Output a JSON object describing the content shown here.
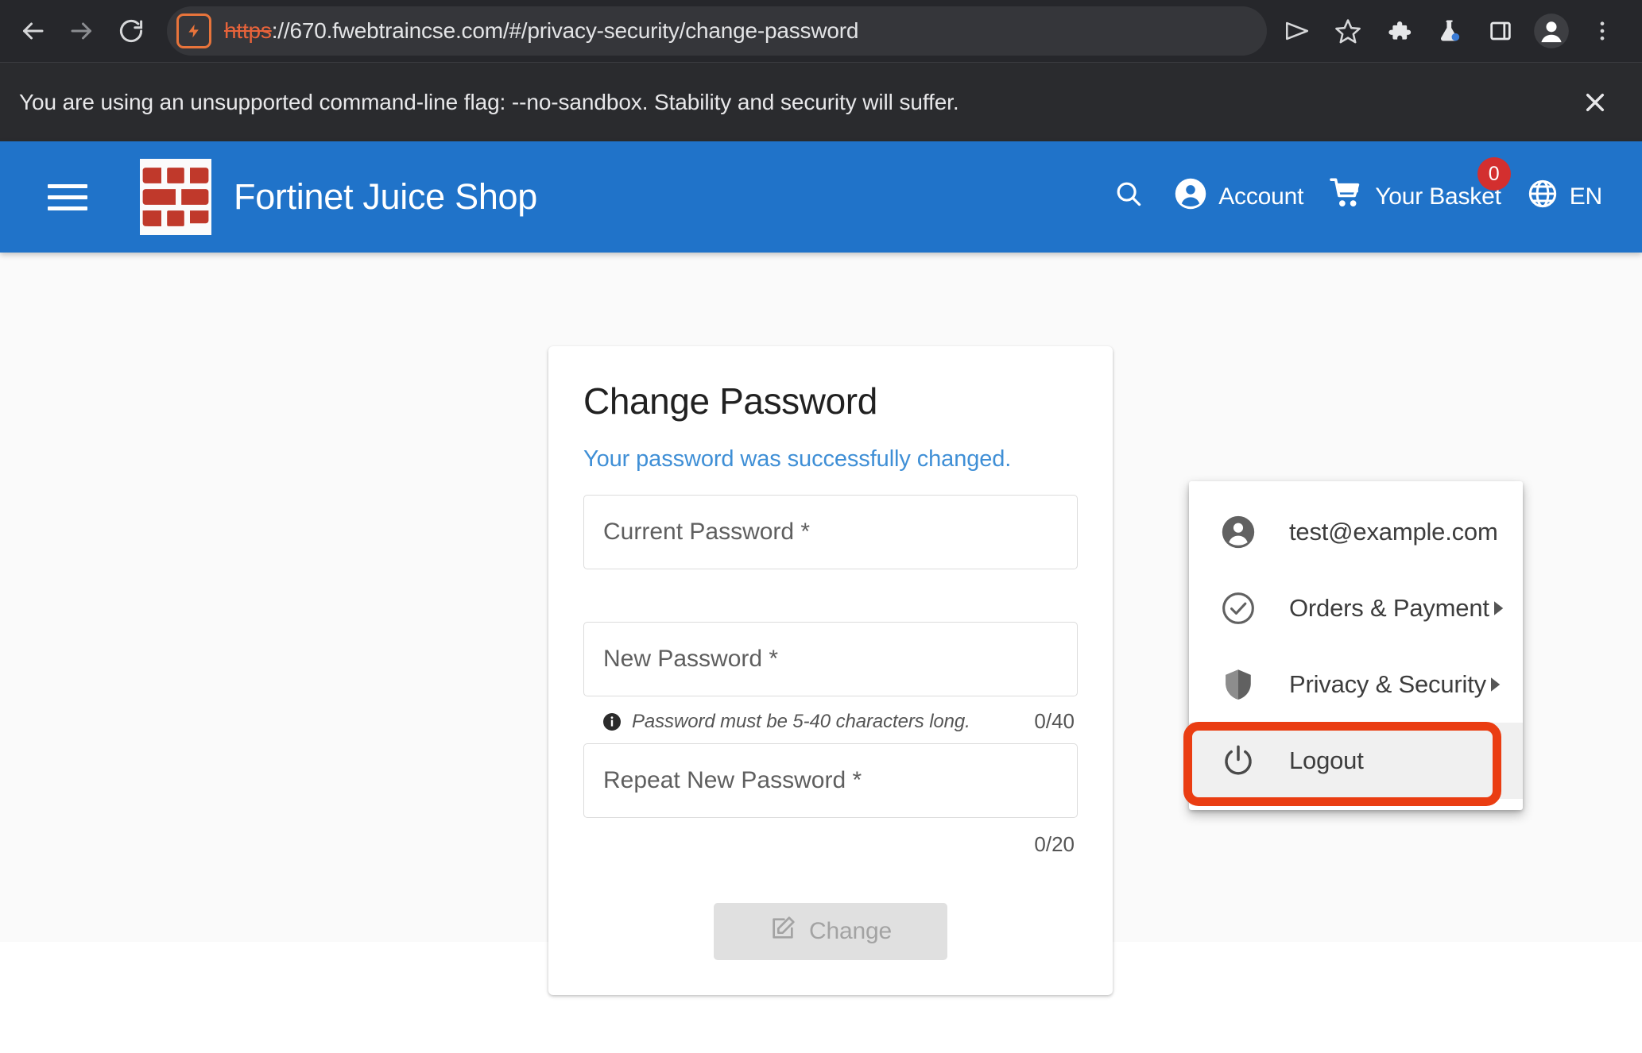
{
  "browser": {
    "nav": {
      "back_icon": "arrow-left-icon",
      "forward_icon": "arrow-right-icon",
      "reload_icon": "reload-icon"
    },
    "omnibox": {
      "site_badge_icon": "not-secure-lightning-icon",
      "url_scheme": "https",
      "url_rest": "://670.fwebtraincse.com/#/privacy-security/change-password",
      "full_url": "https://670.fwebtraincse.com/#/privacy-security/change-password"
    },
    "toolbar_icons": [
      {
        "name": "share-icon"
      },
      {
        "name": "star-bookmark-icon"
      },
      {
        "name": "extensions-puzzle-icon"
      },
      {
        "name": "labs-flask-icon"
      },
      {
        "name": "side-panel-icon"
      },
      {
        "name": "profile-avatar-icon"
      },
      {
        "name": "three-dot-menu-icon"
      }
    ],
    "infobar": {
      "message": "You are using an unsupported command-line flag: --no-sandbox. Stability and security will suffer.",
      "close_icon": "close-icon"
    }
  },
  "app_header": {
    "menu_icon": "hamburger-menu-icon",
    "logo_icon": "fortinet-logo-icon",
    "title": "Fortinet Juice Shop",
    "search_icon": "search-icon",
    "account": {
      "icon": "account-person-icon",
      "label": "Account"
    },
    "basket": {
      "icon": "shopping-cart-icon",
      "label": "Your Basket",
      "badge_count": "0"
    },
    "language": {
      "icon": "globe-icon",
      "label": "EN"
    },
    "colors": {
      "header_blue": "#2073c9",
      "badge_red": "#d32f2f"
    }
  },
  "account_menu": {
    "items": [
      {
        "icon": "account-person-icon",
        "label": "test@example.com",
        "has_submenu": false,
        "highlighted": false
      },
      {
        "icon": "check-circle-icon",
        "label": "Orders & Payment",
        "has_submenu": true,
        "highlighted": false
      },
      {
        "icon": "shield-icon",
        "label": "Privacy & Security",
        "has_submenu": true,
        "highlighted": false
      },
      {
        "icon": "power-icon",
        "label": "Logout",
        "has_submenu": false,
        "highlighted": true
      }
    ],
    "highlight_color": "#ea3d12"
  },
  "change_password_card": {
    "title": "Change Password",
    "success_message": "Your password was successfully changed.",
    "current_password": {
      "placeholder": "Current Password *",
      "value": ""
    },
    "new_password": {
      "placeholder": "New Password *",
      "value": "",
      "hint_icon": "info-icon",
      "hint": "Password must be 5-40 characters long.",
      "counter": "0/40"
    },
    "repeat_password": {
      "placeholder": "Repeat New Password *",
      "value": "",
      "counter": "0/20"
    },
    "submit": {
      "icon": "edit-pencil-icon",
      "label": "Change",
      "disabled": true
    },
    "colors": {
      "success_blue": "#3f8fd6",
      "disabled_button_bg": "#e0e0e0"
    }
  }
}
